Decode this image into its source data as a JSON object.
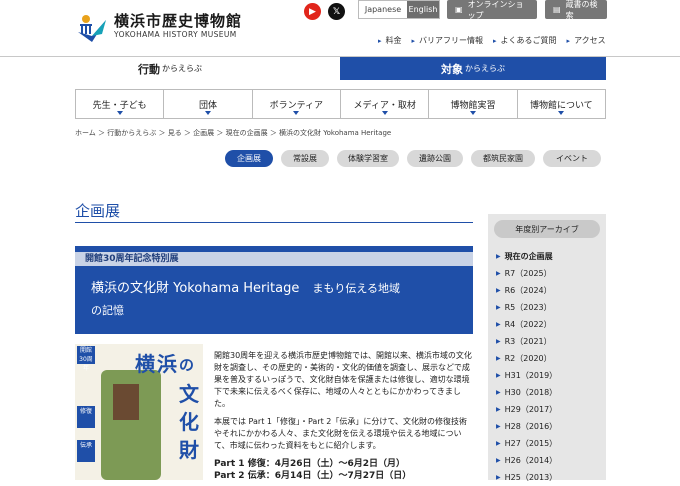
{
  "header": {
    "logo_jp": "横浜市歴史博物館",
    "logo_en": "YOKOHAMA HISTORY MUSEUM",
    "youtube_glyph": "▶",
    "x_glyph": "𝕏",
    "lang_ja": "Japanese",
    "lang_en": "English",
    "shop": "オンラインショップ",
    "search": "蔵書の検索",
    "sublinks": [
      "料金",
      "バリアフリー情報",
      "よくあるご質問",
      "アクセス"
    ]
  },
  "by_tabs": [
    {
      "main": "行動",
      "sub": "からえらぶ"
    },
    {
      "main": "対象",
      "sub": "からえらぶ"
    }
  ],
  "gnav": [
    "先生・子ども",
    "団体",
    "ボランティア",
    "メディア・取材",
    "博物館実習",
    "博物館について"
  ],
  "breadcrumb": "ホーム ＞ 行動からえらぶ ＞ 見る ＞ 企画展 ＞ 現在の企画展 ＞ 横浜の文化財 Yokohama Heritage",
  "pills": [
    "企画展",
    "常設展",
    "体験学習室",
    "遺跡公園",
    "都筑民家園",
    "イベント"
  ],
  "section_title": "企画展",
  "banner": {
    "tag": "開館30周年記念特別展",
    "title_line1": "横浜の文化財 Yokohama Heritage",
    "title_sub": "まもり伝える地域",
    "title_line2": "の記憶"
  },
  "poster": {
    "title_chars": [
      "横",
      "浜",
      "の",
      "文",
      "化",
      "財"
    ],
    "label_top": "開館30周年",
    "part1": "修復",
    "part2": "伝承"
  },
  "body": {
    "p1": "開館30周年を迎える横浜市歴史博物館では、開館以来、横浜市域の文化財を調査し、その歴史的・美術的・文化的価値を調査し、展示などで成果を普及するいっぽうで、文化財自体を保護または修復し、適切な環境下で未来に伝えるべく保存に、地域の人々とともにかかわってきました。",
    "p2": "本展では Part 1「修復」・Part 2「伝承」に分けて、文化財の修復技術やそれにかかわる人々、また文化財を伝える環境や伝える地域について、市域に伝わった資料をもとに紹介します。",
    "date1": "Part 1 修復：4月26日（土）〜6月2日（月）",
    "date2": "Part 2 伝承：6月14日（土）〜7月27日（日）"
  },
  "archive": {
    "heading": "年度別アーカイブ",
    "items": [
      "現在の企画展",
      "R7（2025）",
      "R6（2024）",
      "R5（2023）",
      "R4（2022）",
      "R3（2021）",
      "R2（2020）",
      "H31（2019）",
      "H30（2018）",
      "H29（2017）",
      "H28（2016）",
      "H27（2015）",
      "H26（2014）",
      "H25（2013）"
    ]
  }
}
